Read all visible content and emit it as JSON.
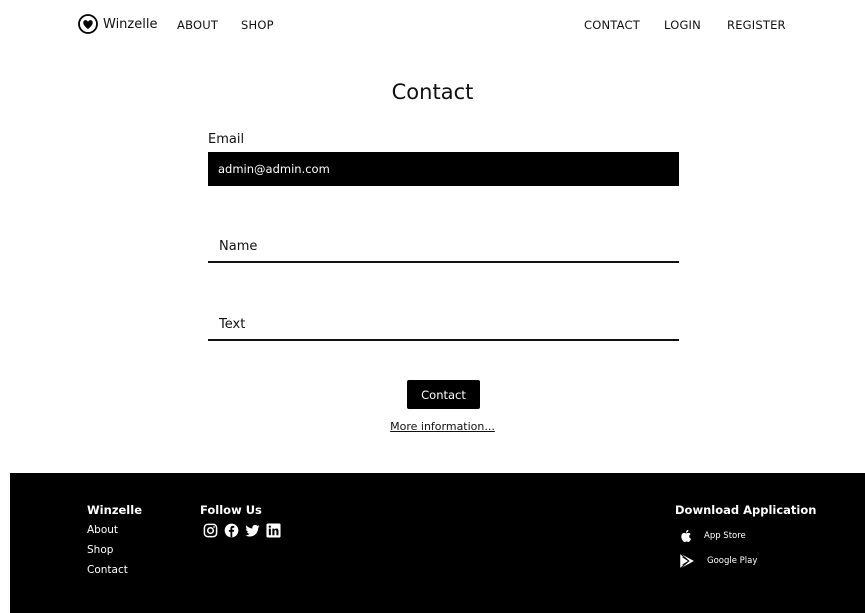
{
  "nav": {
    "brand": "Winzelle",
    "left_links": [
      "ABOUT",
      "SHOP"
    ],
    "right_links": [
      "CONTACT",
      "LOGIN",
      "REGISTER"
    ]
  },
  "main": {
    "title": "Contact",
    "email_label": "Email",
    "email_value": "admin@admin.com",
    "name_placeholder": "Name",
    "text_placeholder": "Text",
    "submit_label": "Contact",
    "more_info": "More information..."
  },
  "footer": {
    "brand_heading": "Winzelle",
    "links": [
      "About",
      "Shop",
      "Contact"
    ],
    "follow_heading": "Follow Us",
    "social_icons": [
      "instagram-icon",
      "facebook-icon",
      "twitter-icon",
      "linkedin-icon"
    ],
    "download_heading": "Download Application",
    "stores": [
      {
        "label": "App Store",
        "icon": "apple-icon"
      },
      {
        "label": "Google Play",
        "icon": "google-play-icon"
      }
    ]
  },
  "colors": {
    "primary": "#000000",
    "background": "#ffffff",
    "text": "#111111"
  }
}
